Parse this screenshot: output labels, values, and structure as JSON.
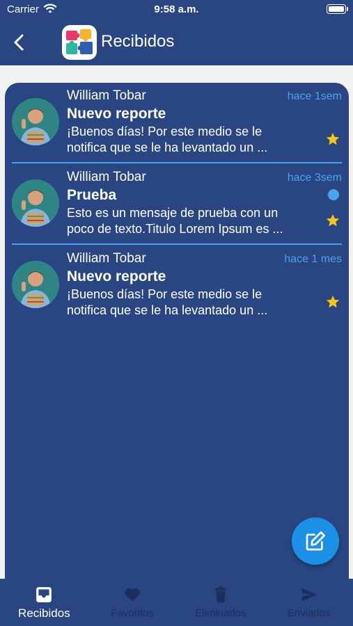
{
  "status_bar": {
    "carrier": "Carrier",
    "time": "9:58 a.m."
  },
  "header": {
    "title": "Recibidos",
    "back_icon": "chevron-left-icon",
    "logo": "puzzle-logo"
  },
  "messages": [
    {
      "sender": "William Tobar",
      "time": "hace 1sem",
      "subject": "Nuevo reporte",
      "preview_line1": "¡Buenos días! Por este medio se le",
      "preview_line2": "notifica que se le ha levantado un ...",
      "favorite": true,
      "unread": false
    },
    {
      "sender": "William Tobar",
      "time": "hace 3sem",
      "subject": "Prueba",
      "preview_line1": "Esto es un mensaje de prueba con un",
      "preview_line2": "poco de texto.Titulo Lorem Ipsum es ...",
      "favorite": true,
      "unread": true
    },
    {
      "sender": "William Tobar",
      "time": "hace 1 mes",
      "subject": "Nuevo reporte",
      "preview_line1": "¡Buenos días! Por este medio se le",
      "preview_line2": "notifica que se le ha levantado un ...",
      "favorite": true,
      "unread": false
    }
  ],
  "colors": {
    "accent": "#4aa3ee",
    "star": "#f5c518",
    "primary": "#294682",
    "fab": "#1c8fe6"
  },
  "fab": {
    "icon": "compose-icon"
  },
  "bottom_nav": [
    {
      "label": "Recibidos",
      "icon": "inbox-icon",
      "active": true
    },
    {
      "label": "Favoritos",
      "icon": "heart-icon",
      "active": false
    },
    {
      "label": "Eliminados",
      "icon": "trash-icon",
      "active": false
    },
    {
      "label": "Enviados",
      "icon": "send-icon",
      "active": false
    }
  ]
}
